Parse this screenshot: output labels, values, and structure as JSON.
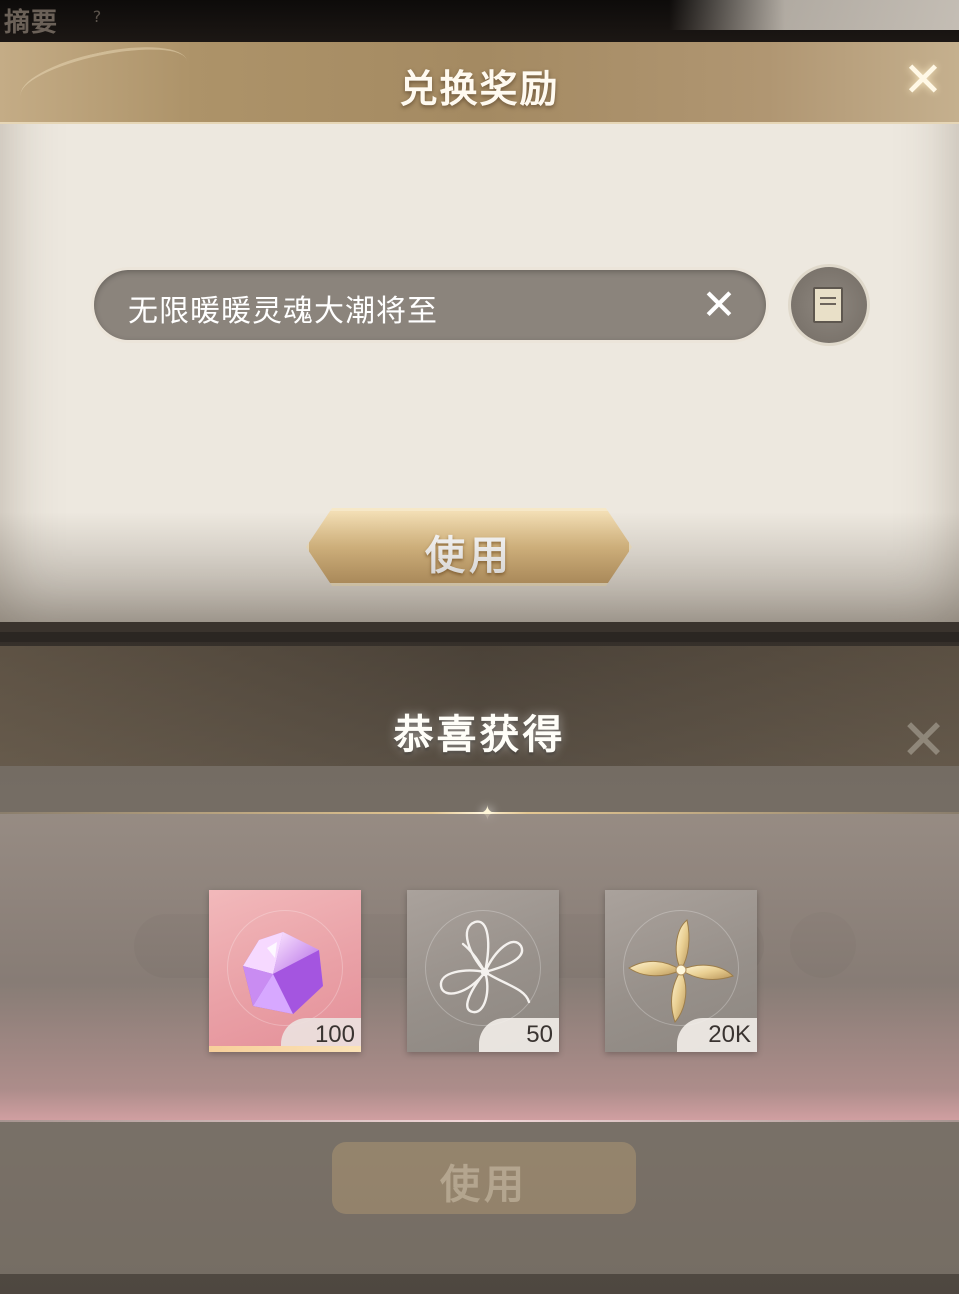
{
  "background": {
    "summary_title": "摘要",
    "help_glyph": "?"
  },
  "redeem_dialog": {
    "title": "兑换奖励",
    "close_glyph": "✕",
    "code_value": "无限暖暖灵魂大潮将至",
    "clear_glyph": "✕",
    "use_label": "使用"
  },
  "reward_popup": {
    "title": "恭喜获得",
    "items": [
      {
        "icon": "crystal-icon",
        "quantity": "100",
        "tile_color": "#eea3aa"
      },
      {
        "icon": "ribbon-thread-icon",
        "quantity": "50",
        "tile_color": "#9a938d"
      },
      {
        "icon": "gold-flower-icon",
        "quantity": "20K",
        "tile_color": "#9a938d"
      }
    ]
  },
  "dimmed_dialog": {
    "use_label": "使用"
  },
  "colors": {
    "header_gold": "#ad9369",
    "button_gold": "#dfbe85",
    "field_grey": "#8b847c",
    "pink_tile": "#eea3aa"
  }
}
